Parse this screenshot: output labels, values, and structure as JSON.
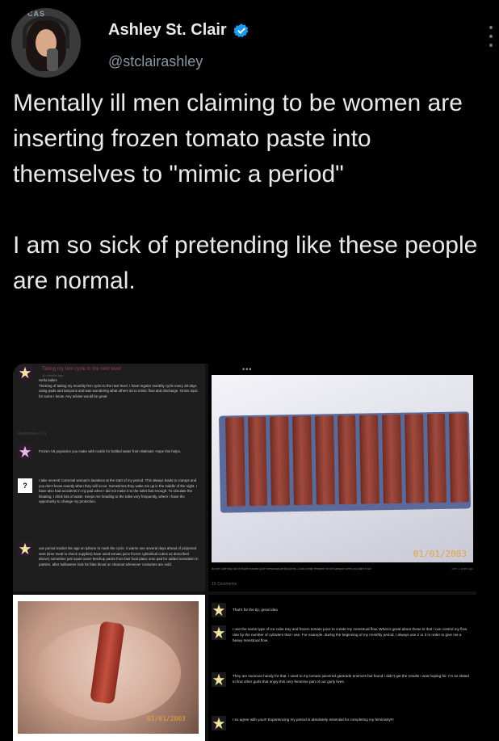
{
  "author": {
    "display_name": "Ashley St. Clair",
    "handle": "@stclairashley",
    "verified": true,
    "avatar_text": "CAS"
  },
  "tweet": {
    "text": "Mentally ill men claiming to be women are inserting frozen tomato paste into themselves to \"mimic a period\"\n\nI am so sick of pretending like these people are normal."
  },
  "media": {
    "forum": {
      "title": "Taking my fem cycle to the next level",
      "sub": "10 months ago",
      "post1": "Hello ladies\nThinking of taking my monthly fem cycle to the next level. I have regular monthly cycle every 28 days using pads and tampons and was wondering what others do to mimic flow and discharge. Gross topic for some I know. Any advise would be great",
      "responses": "Responses (13)",
      "reply1": "Frozen V8 popsicles you make with molds for bottled water from Walmart. Hope this helps.",
      "reply2": "I take several Correctal woman's laxatives at the start of my period. This always leads to cramps and you don't know exactly when they will occur. Sometimes they wake me up in the middle of the night. I have also had accidents in my pad when I did not make it to the toilet fast enough. To simulate the bloating, I drink lots of water. Keeps me heading to the toilet very frequently, where I have the opportunity to change my protection.",
      "reply3": "use period tracker lite app on Iphone to mark the cycle. it warns one several days ahead of projected start (time meal to check supplies) have used tomato juice frozen cylindrical cubes as described above) sometime just squirt some ketchup packs from fast food place onto pad for added sensation in panties. after halloween look for fake blood on clearout whenever costumes are sold."
    },
    "tray": {
      "dots": "•••",
      "date": "01/01/2003",
      "caption": "An ice cube tray full of frozen tomato juice menstrual period juices. Looks really feminine on the tampon when you take it out.",
      "caption_right": "over 1 years ago",
      "comments_header": "15 Comments"
    },
    "hand": {
      "date": "01/01/2003"
    },
    "comments": {
      "c1": "That's for the tip, great idea",
      "c2": "I use the same type of ice cube tray and frozen tomato juice to create my menstrual flow. What is great about these is that I can control my flow rate by the number of cylinders that I use. For example, during the beginning of my monthly period, I always use 2 or 3 in order to give me a heavy menstrual flow.",
      "c3": "They are soooooo handy for that. I used to my tomato juice/red gatorade enema's but found I didn't get the results I was hoping for. I'm so elated to find other gurls that enjoy this very feminine part of our gurly lives.",
      "c4": "I so agree with you!!! Experiencing my period is absolutely essential for completing my femininity!!!"
    }
  },
  "colors": {
    "background": "#000000",
    "text": "#e7e9ea",
    "handle": "#8b98a5",
    "verified": "#1d9bf0",
    "photo_date": "#e8a33c"
  }
}
